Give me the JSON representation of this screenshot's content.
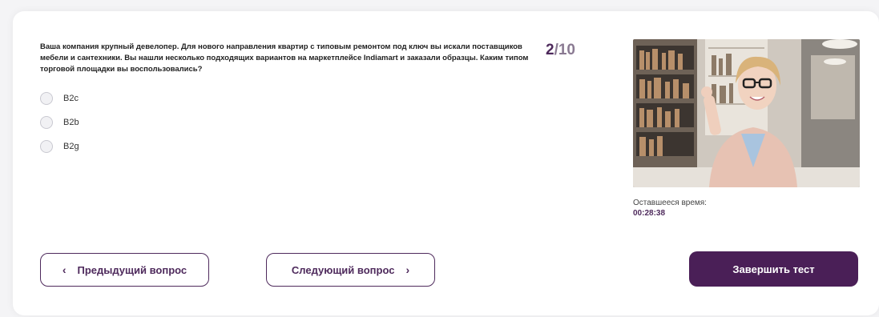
{
  "question": {
    "text": "Ваша компания крупный девелопер. Для нового направления квартир с типовым ремонтом под ключ вы искали поставщиков мебели и сантехники. Вы нашли несколько подходящих вариантов на маркетплейсе Indiamart и заказали образцы. Каким типом торговой площадки вы воспользовались?",
    "options": [
      "B2c",
      "B2b",
      "B2g"
    ]
  },
  "progress": {
    "current": "2",
    "total": "/10"
  },
  "timer": {
    "label": "Оставшееся время:",
    "value": "00:28:38"
  },
  "buttons": {
    "prev_label": "Предыдущий вопрос",
    "next_label": "Следующий вопрос",
    "finish_label": "Завершить тест"
  },
  "colors": {
    "accent": "#4a1f57",
    "accent_text": "#4e2a5c"
  }
}
